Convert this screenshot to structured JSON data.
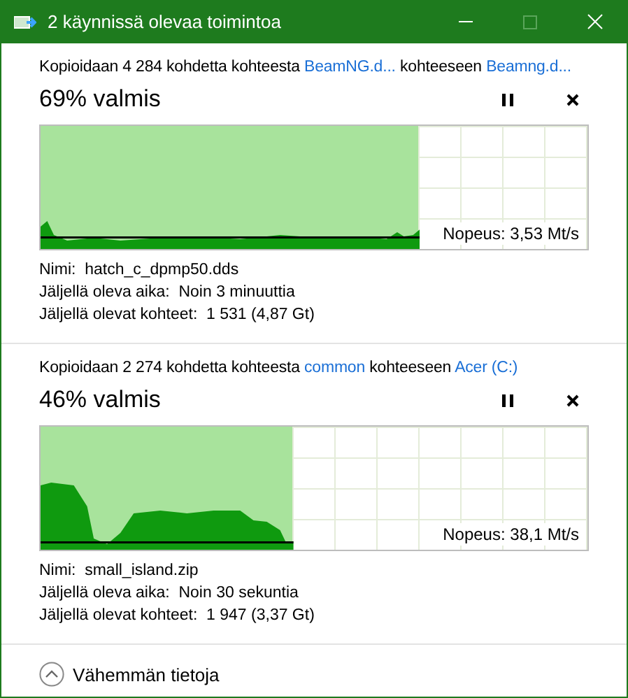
{
  "window": {
    "title": "2 käynnissä olevaa toimintoa"
  },
  "operations": [
    {
      "prefix": "Kopioidaan 4 284 kohdetta kohteesta",
      "source": "BeamNG.d...",
      "connector": "kohteeseen",
      "destination": "Beamng.d...",
      "progress": "69% valmis",
      "level": 0.69,
      "speed": "Nopeus: 3,53 Mt/s",
      "details": [
        {
          "label": "Nimi:",
          "value": "hatch_c_dpmp50.dds"
        },
        {
          "label": "Jäljellä oleva aika:",
          "value": "Noin 3 minuuttia"
        },
        {
          "label": "Jäljellä olevat kohteet:",
          "value": "1 531 (4,87 Gt)"
        }
      ]
    },
    {
      "prefix": "Kopioidaan 2 274 kohdetta kohteesta",
      "source": "common",
      "connector": "kohteeseen",
      "destination": "Acer (C:)",
      "progress": "46% valmis",
      "level": 0.46,
      "speed": "Nopeus: 38,1 Mt/s",
      "details": [
        {
          "label": "Nimi:",
          "value": "small_island.zip"
        },
        {
          "label": "Jäljellä oleva aika:",
          "value": "Noin 30 sekuntia"
        },
        {
          "label": "Jäljellä olevat kohteet:",
          "value": "1 947 (3,37 Gt)"
        }
      ]
    }
  ],
  "footer": {
    "label": "Vähemmän tietoja"
  }
}
